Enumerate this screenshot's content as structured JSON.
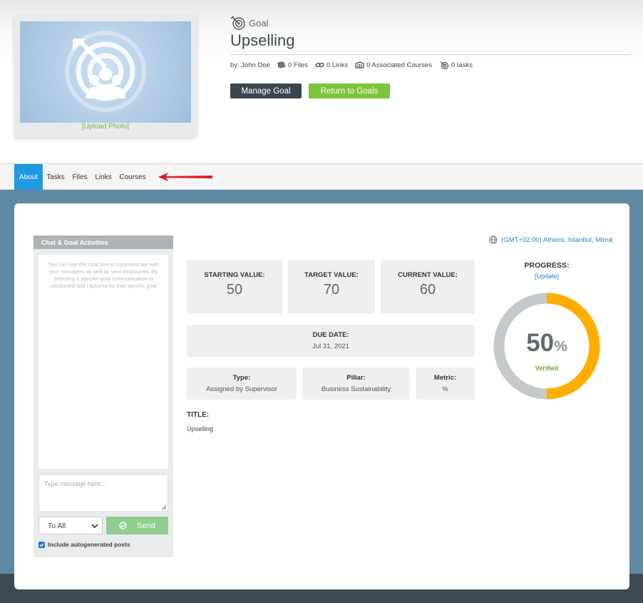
{
  "header": {
    "upload_photo": "[Upload Photo]",
    "section_label": "Goal",
    "title": "Upselling",
    "meta": {
      "author": "by: John Doe",
      "files": "0 Files",
      "links": "0 Links",
      "courses": "0 Associated Courses",
      "tasks": "0 tasks"
    },
    "buttons": {
      "manage": "Manage Goal",
      "return": "Return to Goals"
    }
  },
  "tabs": [
    {
      "label": "About",
      "active": true
    },
    {
      "label": "Tasks"
    },
    {
      "label": "Files"
    },
    {
      "label": "Links"
    },
    {
      "label": "Courses"
    }
  ],
  "chat": {
    "title": "Chat & Goal Activities",
    "help_text": "You can use this chat box to communicate with your managers as well as your employees. By selecting a specific goal communication is conducted and captured for that specific goal",
    "input_placeholder": "Type message here...",
    "recipient_selected": "To All",
    "send_label": "Send",
    "autogen_label": "Include autogenerated posts",
    "autogen_checked": true
  },
  "timezone": "(GMT+02:00) Athens, Istanbul, Minsk",
  "values": {
    "starting_label": "STARTING VALUE:",
    "starting": "50",
    "target_label": "TARGET VALUE:",
    "target": "70",
    "current_label": "CURRENT VALUE:",
    "current": "60"
  },
  "due": {
    "label": "DUE DATE:",
    "value": "Jul 31, 2021"
  },
  "details": {
    "type_label": "Type:",
    "type": "Assigned by Supervisor",
    "pillar_label": "Pillar:",
    "pillar": "Business Sustainability",
    "metric_label": "Metric:",
    "metric": "%"
  },
  "goal_title": {
    "label": "TITLE:",
    "value": "Upselling"
  },
  "progress": {
    "label": "PROGRESS:",
    "update": "[Update]",
    "percent": 50,
    "percent_text": "50",
    "percent_sign": "%",
    "status": "Verified"
  },
  "colors": {
    "accent": "#1e9ae0",
    "dark_button": "#3c4651",
    "green": "#7cc43a",
    "progress_fill": "#ffae00",
    "progress_track": "#c6c9cc"
  }
}
